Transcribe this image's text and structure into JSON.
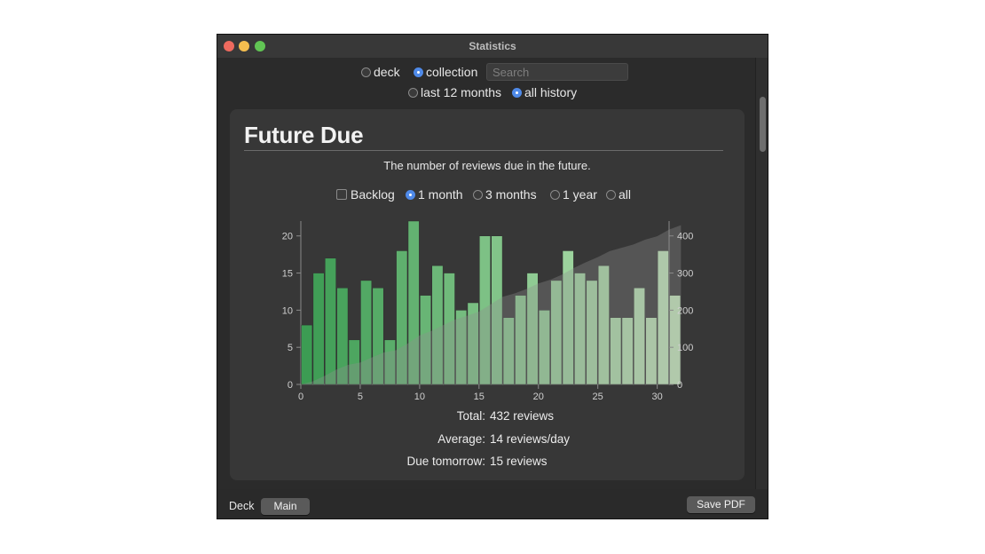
{
  "window": {
    "title": "Statistics"
  },
  "scope": {
    "options": [
      {
        "label": "deck",
        "selected": false
      },
      {
        "label": "collection",
        "selected": true
      }
    ],
    "search_placeholder": "Search",
    "period_options": [
      {
        "label": "last 12 months",
        "selected": false
      },
      {
        "label": "all history",
        "selected": true
      }
    ]
  },
  "card": {
    "title": "Future Due",
    "subtitle": "The number of reviews due in the future.",
    "backlog_label": "Backlog",
    "range_options": [
      {
        "label": "1 month",
        "selected": true
      },
      {
        "label": "3 months",
        "selected": false
      },
      {
        "label": "1 year",
        "selected": false
      },
      {
        "label": "all",
        "selected": false
      }
    ],
    "stats": [
      {
        "label": "Total:",
        "value": "432 reviews"
      },
      {
        "label": "Average:",
        "value": "14 reviews/day"
      },
      {
        "label": "Due tomorrow:",
        "value": "15 reviews"
      }
    ]
  },
  "bottom": {
    "deck_label": "Deck",
    "deck_button": "Main",
    "save_button": "Save PDF"
  },
  "colors": {
    "bar_dark": "#3c9c53",
    "bar_light": "#c3e9bb",
    "area": "#8f8f8f"
  },
  "chart_data": {
    "type": "bar",
    "x": [
      0,
      1,
      2,
      3,
      4,
      5,
      6,
      7,
      8,
      9,
      10,
      11,
      12,
      13,
      14,
      15,
      16,
      17,
      18,
      19,
      20,
      21,
      22,
      23,
      24,
      25,
      26,
      27,
      28,
      29,
      30
    ],
    "values": [
      8,
      15,
      17,
      13,
      6,
      14,
      13,
      6,
      18,
      22,
      12,
      16,
      15,
      10,
      11,
      20,
      20,
      9,
      12,
      15,
      10,
      14,
      18,
      15,
      14,
      16,
      9,
      9,
      13,
      9,
      18,
      12
    ],
    "cumulative": true,
    "xlim": [
      0,
      31
    ],
    "ylim": [
      0,
      22
    ],
    "y2lim": [
      0,
      440
    ],
    "x_ticks": [
      0,
      5,
      10,
      15,
      20,
      25,
      30
    ],
    "y_ticks": [
      0,
      5,
      10,
      15,
      20
    ],
    "y2_ticks": [
      0,
      100,
      200,
      300,
      400
    ]
  }
}
